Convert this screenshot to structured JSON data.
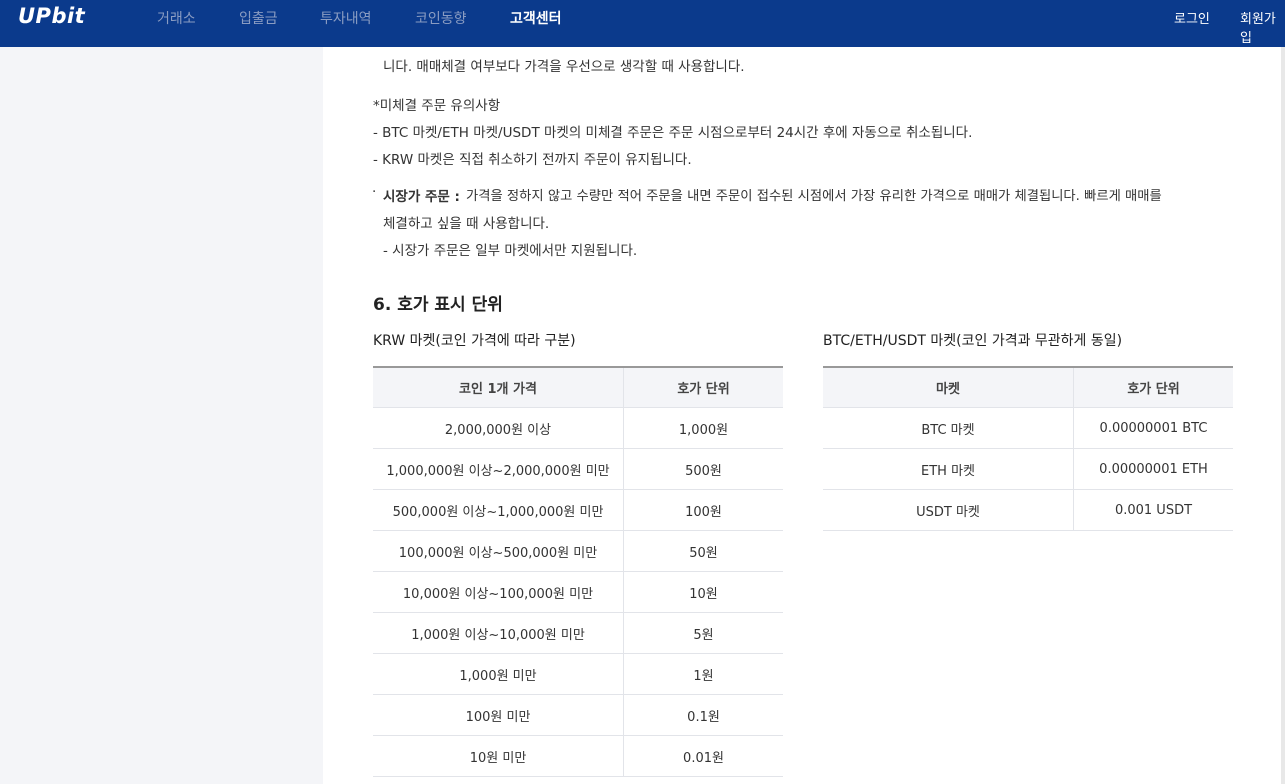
{
  "header": {
    "logo": "UPbit",
    "nav": [
      "거래소",
      "입출금",
      "투자내역",
      "코인동향",
      "고객센터"
    ],
    "active_nav_index": 4,
    "login": "로그인",
    "signup": "회원가입"
  },
  "content": {
    "line_limit_tail": "니다. 매매체결 여부보다 가격을 우선으로 생각할 때 사용합니다.",
    "unfilled_title": "*미체결 주문 유의사항",
    "unfilled_1": "- BTC 마켓/ETH 마켓/USDT 마켓의 미체결 주문은 주문 시점으로부터 24시간 후에 자동으로 취소됩니다.",
    "unfilled_2": "- KRW 마켓은 직접 취소하기 전까지 주문이 유지됩니다.",
    "market_bullet": "·",
    "market_label": "시장가 주문 :",
    "market_desc_1": "가격을 정하지 않고 수량만 적어 주문을 내면 주문이 접수된 시점에서 가장 유리한 가격으로 매매가 체결됩니다. 빠르게 매매를",
    "market_desc_2": "체결하고 싶을 때 사용합니다.",
    "market_note": "- 시장가 주문은 일부 마켓에서만 지원됩니다.",
    "section_title": "6. 호가 표시 단위"
  },
  "krw_table": {
    "caption": "KRW 마켓(코인 가격에 따라 구분)",
    "headers": [
      "코인 1개 가격",
      "호가 단위"
    ],
    "rows": [
      [
        "2,000,000원 이상",
        "1,000원"
      ],
      [
        "1,000,000원 이상~2,000,000원 미만",
        "500원"
      ],
      [
        "500,000원 이상~1,000,000원 미만",
        "100원"
      ],
      [
        "100,000원 이상~500,000원 미만",
        "50원"
      ],
      [
        "10,000원 이상~100,000원 미만",
        "10원"
      ],
      [
        "1,000원 이상~10,000원 미만",
        "5원"
      ],
      [
        "1,000원 미만",
        "1원"
      ],
      [
        "100원 미만",
        "0.1원"
      ],
      [
        "10원 미만",
        "0.01원"
      ]
    ]
  },
  "other_table": {
    "caption": "BTC/ETH/USDT 마켓(코인 가격과 무관하게 동일)",
    "headers": [
      "마켓",
      "호가 단위"
    ],
    "rows": [
      [
        "BTC 마켓",
        "0.00000001 BTC"
      ],
      [
        "ETH 마켓",
        "0.00000001 ETH"
      ],
      [
        "USDT 마켓",
        "0.001 USDT"
      ]
    ]
  }
}
